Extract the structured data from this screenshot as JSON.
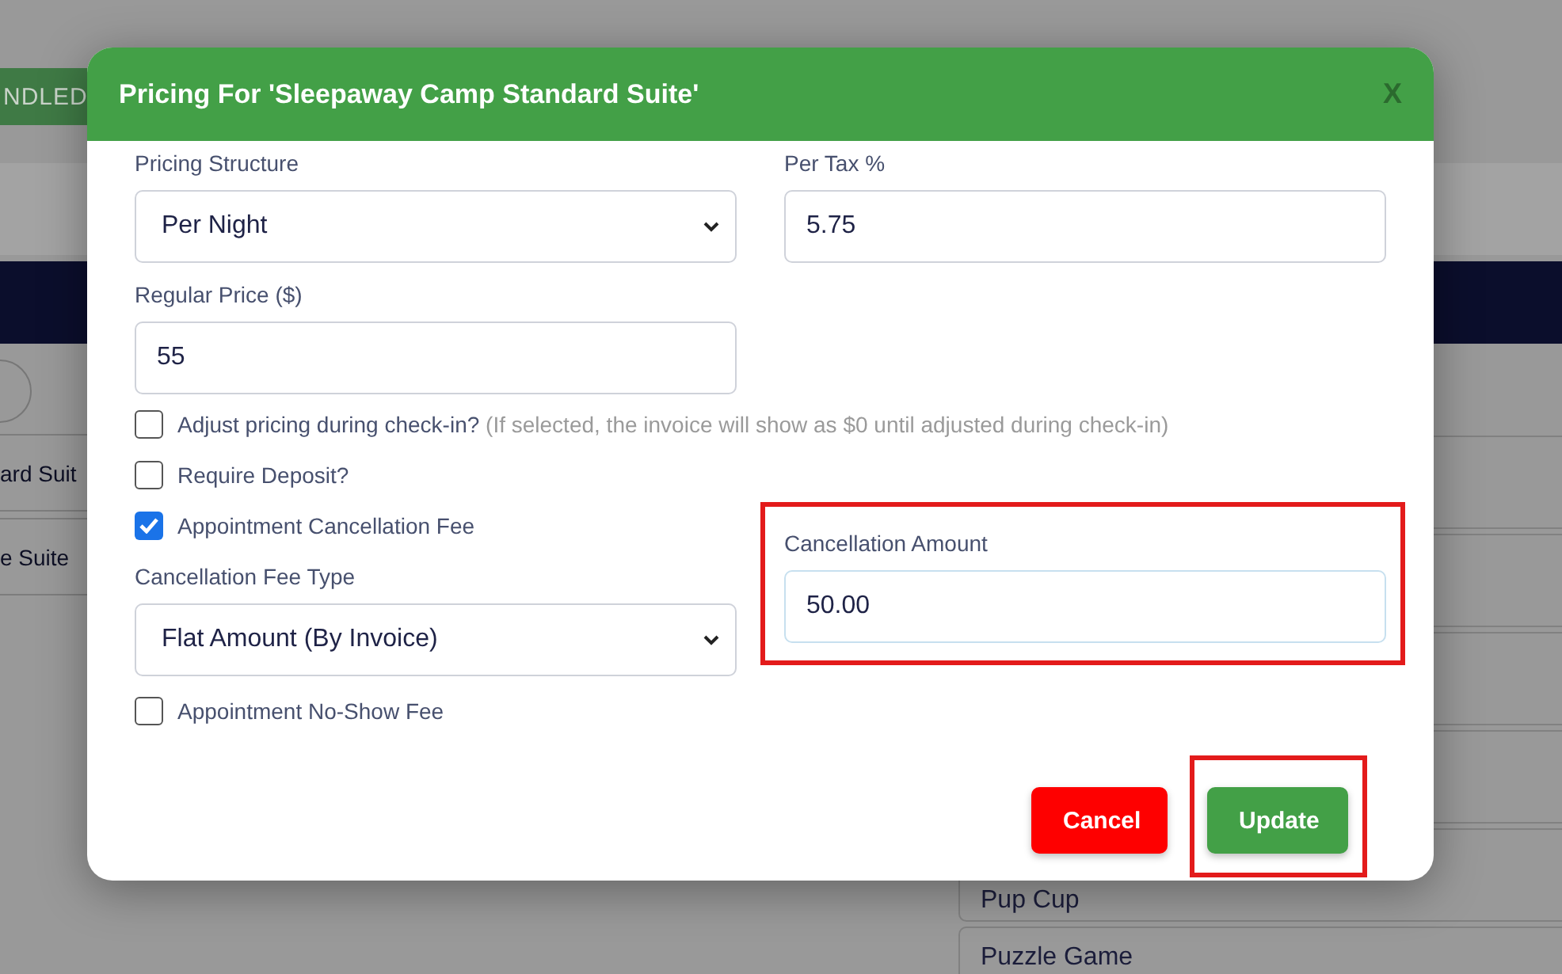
{
  "background": {
    "badge": "NDLED",
    "left_rows": [
      "ard Suit",
      "e Suite"
    ],
    "right_rows": [
      {
        "label": ""
      },
      {
        "label": ""
      },
      {
        "label": ""
      },
      {
        "label": ""
      },
      {
        "label": "Pup Cup"
      },
      {
        "label": "Puzzle Game"
      }
    ]
  },
  "dialog": {
    "title": "Pricing For 'Sleepaway Camp Standard Suite'",
    "close": "X",
    "pricing_structure": {
      "label": "Pricing Structure",
      "value": "Per Night"
    },
    "per_tax": {
      "label": "Per Tax %",
      "value": "5.75"
    },
    "regular_price": {
      "label": "Regular Price ($)",
      "value": "55"
    },
    "adjust_pricing": {
      "label": "Adjust pricing during check-in?",
      "note": "(If selected, the invoice will show as $0 until adjusted during check-in)",
      "checked": false
    },
    "require_deposit": {
      "label": "Require Deposit?",
      "checked": false
    },
    "cancellation_fee": {
      "label": "Appointment Cancellation Fee",
      "checked": true
    },
    "cancellation_fee_type": {
      "label": "Cancellation Fee Type",
      "value": "Flat Amount (By Invoice)"
    },
    "cancellation_amount": {
      "label": "Cancellation Amount",
      "value": "50.00",
      "highlighted": true
    },
    "no_show_fee": {
      "label": "Appointment No-Show Fee",
      "checked": false
    },
    "buttons": [
      {
        "label": "Cancel",
        "kind": "danger",
        "highlighted": false
      },
      {
        "label": "Update",
        "kind": "primary",
        "highlighted": true
      }
    ]
  }
}
